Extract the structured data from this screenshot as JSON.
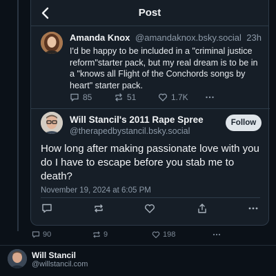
{
  "header": {
    "title": "Post"
  },
  "quoted_post": {
    "author_name": "Amanda Knox",
    "handle": "@amandaknox.bsky.social",
    "time": "23h",
    "text": "I'd be happy to be included in a \"criminal justice reform\"starter pack, but my real dream is to be in a \"knows all Flight of the Conchords songs by heart\" starter pack.",
    "replies": "85",
    "reposts": "51",
    "likes": "1.7K"
  },
  "main_post": {
    "author_name": "Will Stancil's 2011 Rape Spree",
    "handle": "@therapedbystancil.bsky.social",
    "follow_label": "Follow",
    "text": "How long after making passionate love with you do I have to escape before you stab me to death?",
    "date": "November 19, 2024 at 6:05 PM"
  },
  "outer_post": {
    "replies": "90",
    "reposts": "9",
    "likes": "198"
  },
  "next_post": {
    "author_name": "Will Stancil",
    "handle": "@willstancil.com"
  },
  "icons": {
    "back": "chevron-left-icon",
    "reply": "speech-bubble-icon",
    "repost": "repost-arrows-icon",
    "like": "heart-icon",
    "share": "share-upload-icon",
    "more": "more-dots-icon"
  }
}
